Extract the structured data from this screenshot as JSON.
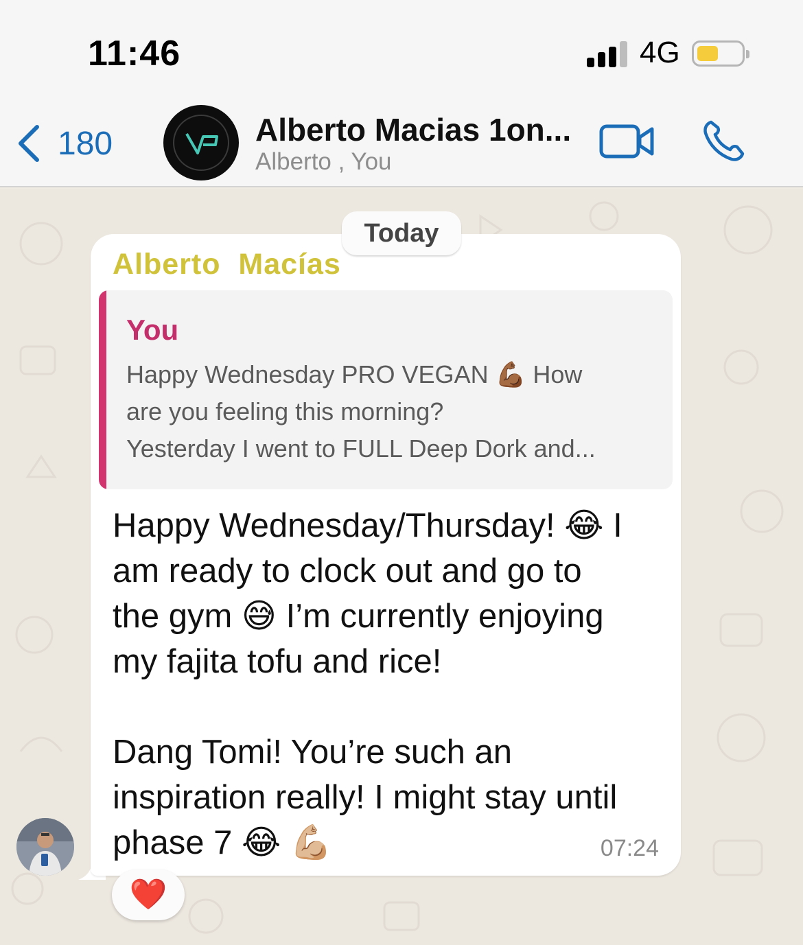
{
  "status_bar": {
    "time": "11:46",
    "network": "4G",
    "battery_level": 0.45,
    "battery_color": "#f5cd3c"
  },
  "header": {
    "back_count": "180",
    "title": "Alberto Macias 1on...",
    "subtitle": "Alberto , You",
    "accent_color": "#1c6db8",
    "icons": [
      "chevron-left-icon",
      "video-call-icon",
      "phone-icon"
    ]
  },
  "chat": {
    "date_label": "Today",
    "message": {
      "sender": "Alberto  Macías",
      "sender_color": "#d0c23a",
      "quote": {
        "author": "You",
        "author_color": "#c42e6b",
        "line1": "Happy Wednesday PRO VEGAN 💪🏾 How",
        "line2": "are you feeling this morning?",
        "line3": "Yesterday I went to FULL Deep Dork and..."
      },
      "lines": [
        "Happy Wednesday/Thursday! 😂 I",
        "am ready to clock out and go to",
        "the gym 😅 I’m currently enjoying",
        "my fajita tofu and rice!",
        "",
        "Dang Tomi! You’re such an",
        "inspiration really! I might stay until",
        "phase 7 😂 💪🏼"
      ],
      "time": "07:24",
      "reaction": "❤️"
    }
  }
}
